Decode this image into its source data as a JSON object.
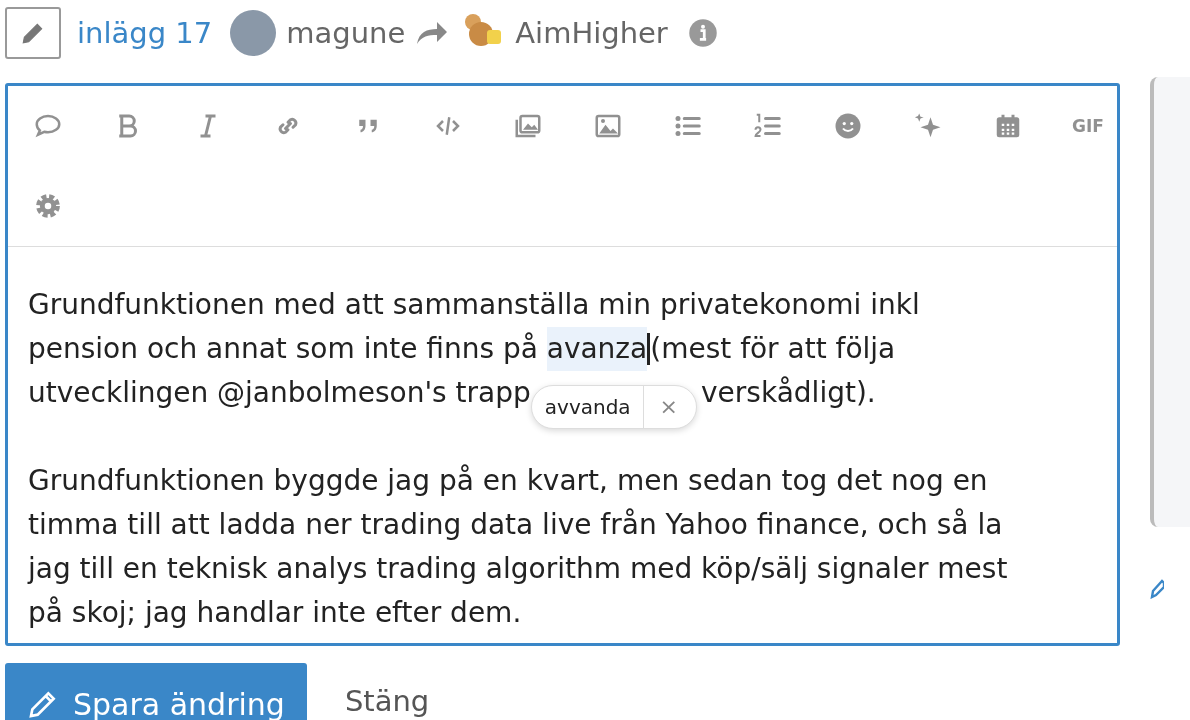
{
  "header": {
    "post_link": "inlägg 17",
    "author": "magune",
    "reply_to": "AimHigher"
  },
  "toolbar": {
    "gif_label": "GIF"
  },
  "paragraphs": [
    {
      "lines": [
        [
          {
            "text": "Grundfunktionen med att sammanställa min privatekonomi inkl",
            "kind": "plain"
          }
        ],
        [
          {
            "text": "pension och annat som inte finns på ",
            "kind": "plain"
          },
          {
            "text": "avanza",
            "kind": "misspelled"
          },
          {
            "text": "(mest för att följa",
            "kind": "plain"
          }
        ],
        [
          {
            "text": "utvecklingen @janbolmeson's trapp",
            "kind": "plain"
          },
          {
            "text": "verskådligt).",
            "kind": "after_popup"
          }
        ]
      ]
    },
    {
      "lines": [
        [
          {
            "text": "Grundfunktionen byggde jag på en kvart, men sedan tog det nog en",
            "kind": "plain"
          }
        ],
        [
          {
            "text": "timma till att ladda ner trading data live från Yahoo finance, och så la",
            "kind": "plain"
          }
        ],
        [
          {
            "text": "jag till en teknisk analys trading algorithm med köp/sälj signaler mest",
            "kind": "plain"
          }
        ],
        [
          {
            "text": "på skoj; jag handlar inte efter dem.",
            "kind": "plain"
          }
        ]
      ]
    }
  ],
  "suggestion": {
    "word": "avvanda",
    "dismiss": "×"
  },
  "buttons": {
    "save": "Spara ändring",
    "close": "Stäng"
  }
}
